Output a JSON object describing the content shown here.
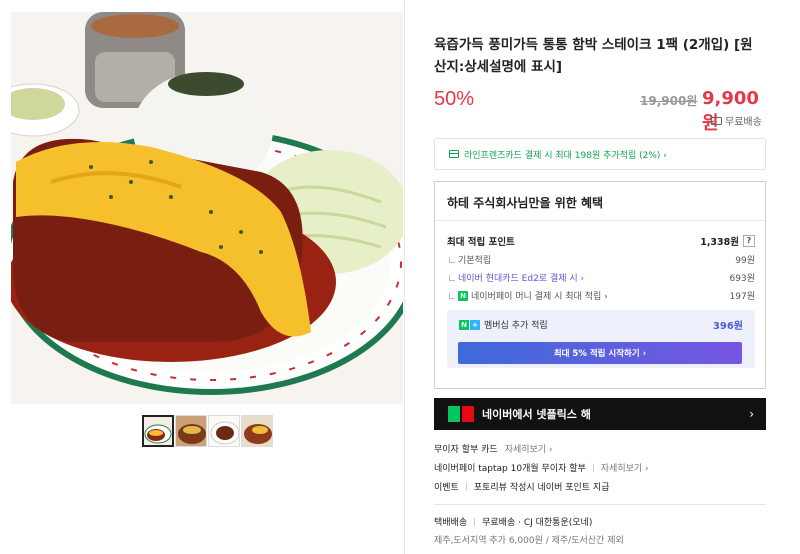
{
  "product": {
    "title": "육즙가득 풍미가득 통통 함박 스테이크 1팩 (2개입) [원산지:상세설명에 표시]",
    "discount": "50%",
    "original_price": "19,900원",
    "sale_price": "9,900원",
    "shipping_label": "무료배송"
  },
  "card_banner": {
    "text": "라인프렌즈카드 결제 시 최대 198원 추가적립 (2%) ›"
  },
  "benefit": {
    "title": "하테 주식회사님만을 위한 혜택",
    "max_points_label": "최대 적립 포인트",
    "max_points_value": "1,338원",
    "help": "?",
    "rows": [
      {
        "label": "기본적립",
        "value": "99원"
      },
      {
        "label": "네이버 현대카드 Ed2로 결제 시 ›",
        "value": "693원"
      },
      {
        "label": "네이버페이 머니 결제 시 최대 적립 ›",
        "value": "197원"
      }
    ],
    "member_label": "멤버십 추가 적립",
    "member_points": "396원",
    "member_button": "최대 5% 적립 시작하기 ›"
  },
  "netflix": {
    "text": "네이버에서 넷플릭스 해",
    "arrow": "›"
  },
  "info": {
    "card_free": "무이자 할부 카드",
    "card_free_more": "자세히보기 ›",
    "npay_free": "네이버페이 taptap 10개월 무이자 할부",
    "npay_free_more": "자세히보기 ›",
    "event_label": "이벤트",
    "event_text": "포토리뷰 작성시 네이버 포인트 지급",
    "delivery_type": "택배배송",
    "delivery_info": "무료배송 · CJ 대한통운(오네)",
    "delivery_extra": "제주,도서지역 추가 6,000원 / 제주/도서산간 제외"
  },
  "colors": {
    "accent_red": "#e8364b",
    "naver_green": "#03c75a",
    "member_purple": "#4e5bd8"
  }
}
